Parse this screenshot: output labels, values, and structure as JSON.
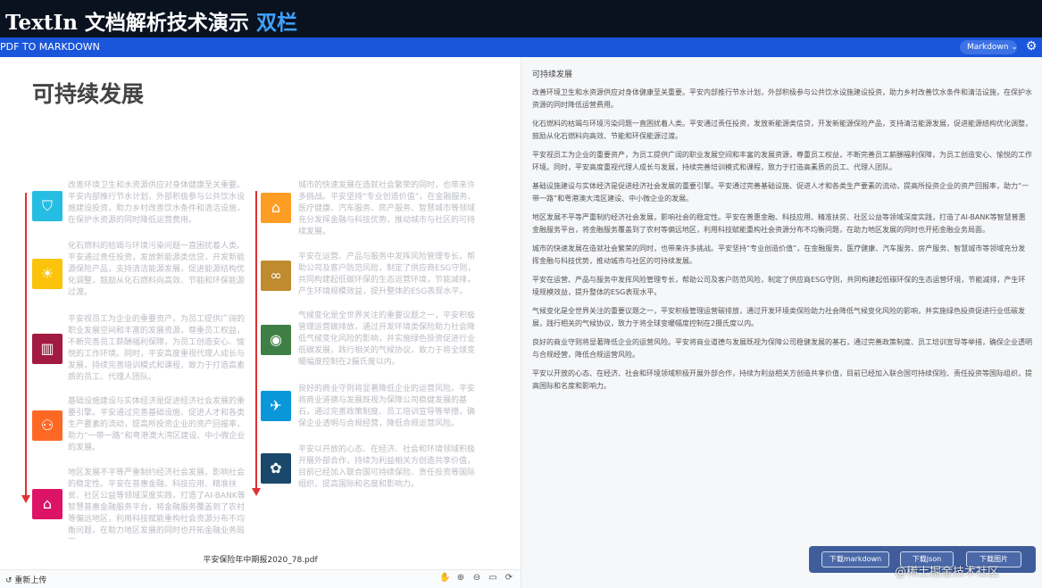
{
  "banner": {
    "title": "TextIn 文档解析技术演示",
    "highlight": "双栏"
  },
  "topbar": {
    "title": "PDF TO MARKDOWN",
    "view_mode": "Markdown",
    "view_caret": "⌄",
    "settings_icon": "gear-icon"
  },
  "left_panel": {
    "doc_title": "可持续发展",
    "pdf_name": "平安保险年中期报2020_78.pdf",
    "upload_label": "重新上传",
    "upload_icon": "↺",
    "tool_icons": [
      "hand-icon",
      "zoom-in-icon",
      "zoom-out-icon",
      "fit-page-icon",
      "rotate-icon"
    ],
    "tool_glyphs": [
      "✋",
      "⊕",
      "⊖",
      "▭",
      "⟳"
    ],
    "sdg_icons": [
      {
        "name": "sdg-6-icon",
        "glyph": "⛉",
        "color": "#26bde2"
      },
      {
        "name": "sdg-7-icon",
        "glyph": "☀",
        "color": "#fcc30b"
      },
      {
        "name": "sdg-8-icon",
        "glyph": "▥",
        "color": "#a21942"
      },
      {
        "name": "sdg-10-icon",
        "glyph": "⚇",
        "color": "#fd6925"
      },
      {
        "name": "sdg-11-icon",
        "glyph": "⌂",
        "color": "#dd1367"
      },
      {
        "name": "sdg-12-icon",
        "glyph": "⌂",
        "color": "#fd9d24"
      },
      {
        "name": "sdg-infinity-icon",
        "glyph": "∞",
        "color": "#bf8b2e"
      },
      {
        "name": "sdg-13-icon",
        "glyph": "◉",
        "color": "#3f7e44"
      },
      {
        "name": "sdg-14-icon",
        "glyph": "✈",
        "color": "#0a97d9"
      },
      {
        "name": "sdg-17-icon",
        "glyph": "✿",
        "color": "#19486a"
      }
    ]
  },
  "markdown": {
    "heading": "可持续发展",
    "paragraphs": [
      "改善环境卫生和水资源供应对身体健康至关重要。平安内部推行节水计划，外部积极参与公共饮水设施建设投资，助力乡村改善饮水条件和清洁设施，在保护水资源的同时降低运营费用。",
      "化石燃料的枯竭与环境污染问题一直困扰着人类。平安通过责任投资，发放新能源类信贷，开发新能源保险产品，支持清洁能源发展，促进能源结构优化调整，鼓励从化石燃料向高效、节能和环保能源过渡。",
      "平安视员工为企业的重要资产，为员工提供广阔的职业发展空间和丰富的发展资源，尊重员工权益，不断完善员工薪酬福利保障，为员工创造安心、愉悦的工作环境。同时，平安高度重视代理人成长与发展，持续完善培训模式和课程，致力于打造高素质的员工、代理人团队。",
      "基础设施建设与实体经济是促进经济社会发展的重要引擎。平安通过完善基础设施、促进人才和各类生产要素的流动，提高所投资企业的资产回报率，助力“一带一路”和粤港澳大湾区建设、中小微企业的发展。",
      "地区发展不平等严重制约经济社会发展，影响社会的稳定性。平安在普惠金融、科技应用、精准扶贫、社区公益等领域深度实践，打造了AI-BANK等智慧普惠金融服务平台，将金融服务覆盖到了农村等偏远地区，利用科技赋能重构社会资源分布不均衡问题，在助力地区发展的同时也开拓金融业务局面。",
      "城市的快速发展在造就社会繁荣的同时，也带来许多挑战。平安坚持“专业创造价值”，在金融服务、医疗健康、汽车服务、房产服务、智慧城市等领域充分发挥金融与科技优势，推动城市与社区的可持续发展。",
      "平安在运营、产品与服务中发挥风险管理专长，帮助公司及客户防范风险，制定了供应商ESG守则，共同构建起低碳环保的生态运营环境，节能减排，产生环境规模效益，提升整体的ESG表现水平。",
      "气候变化是全世界关注的重要议题之一，平安积极管理运营碳排放，通过开发环境类保险助力社会降低气候变化风险的影响，并实施绿色投资促进行业低碳发展，践行相关的气候协议，致力于将全球变暖幅度控制在2摄氏度以内。",
      "良好的商业守则将显著降低企业的运营风险。平安将商业道德与发展既视为保障公司稳健发展的基石，通过完善政策制度、员工培训宣导等举措，确保企业透明与合规经营，降低合规运营风险。",
      "平安以开放的心态、在经济、社会和环境领域积极开展外部合作，持续为利益相关方创造共享价值，目前已经加入联合国可持续保险、责任投资等国际组织，提高国际和名度和影响力。"
    ]
  },
  "downloads": {
    "markdown": "下载markdown",
    "json": "下载json",
    "image": "下载图片"
  },
  "watermark": "@稀土掘金技术社区"
}
